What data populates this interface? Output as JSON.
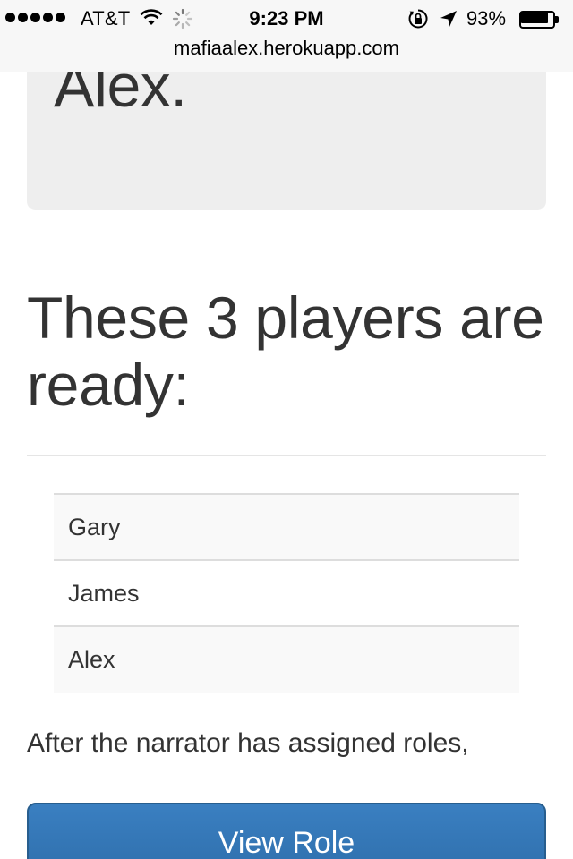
{
  "status_bar": {
    "carrier": "AT&T",
    "time": "9:23 PM",
    "battery_percent": "93%",
    "battery_level": 0.93,
    "signal_icon": "signal-dots-icon",
    "wifi_icon": "wifi-icon",
    "activity_icon": "activity-spinner-icon",
    "lock_icon": "rotation-lock-icon",
    "location_icon": "location-arrow-icon"
  },
  "browser": {
    "url": "mafiaalex.herokuapp.com"
  },
  "jumbotron": {
    "name": "Alex."
  },
  "players": {
    "heading": "These 3 players are ready:",
    "list": [
      "Gary",
      "James",
      "Alex"
    ]
  },
  "info": {
    "text": "After the narrator has assigned roles,"
  },
  "actions": {
    "view_role_label": "View Role"
  },
  "colors": {
    "button_primary": "#3071a9",
    "jumbotron_bg": "#eeeeee",
    "text": "#333333"
  }
}
